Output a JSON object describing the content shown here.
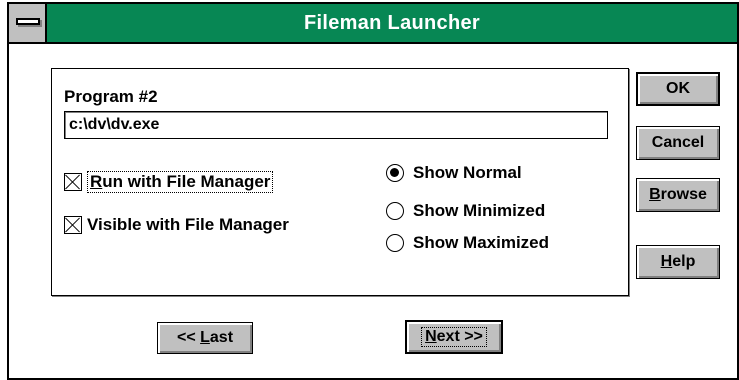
{
  "window": {
    "title": "Fileman Launcher"
  },
  "program": {
    "label": "Program #2",
    "path": "c:\\dv\\dv.exe"
  },
  "checkboxes": [
    {
      "accel": "R",
      "rest": "un with File Manager",
      "checked": true
    },
    {
      "accel": "",
      "rest": "Visible with File Manager",
      "checked": true
    }
  ],
  "radios": [
    {
      "label": "Show Normal",
      "selected": true
    },
    {
      "label": "Show Minimized",
      "selected": false
    },
    {
      "label": "Show Maximized",
      "selected": false
    }
  ],
  "buttons": {
    "ok": "OK",
    "cancel": "Cancel",
    "browse": {
      "accel": "B",
      "rest": "rowse"
    },
    "help": {
      "accel": "H",
      "rest": "elp"
    },
    "last": {
      "pre": "<< ",
      "accel": "L",
      "rest": "ast"
    },
    "next": {
      "accel": "N",
      "rest": "ext >>"
    }
  },
  "colors": {
    "titlebar": "#078754",
    "face": "#c0c0c0"
  }
}
